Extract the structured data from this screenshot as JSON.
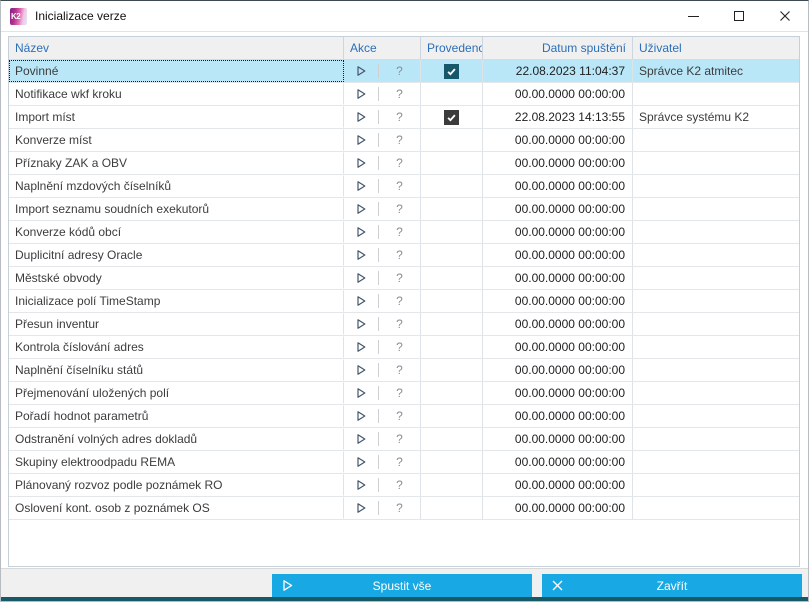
{
  "window": {
    "title": "Inicializace verze",
    "app_badge": "K2"
  },
  "table": {
    "columns": [
      {
        "label": "Název"
      },
      {
        "label": "Akce"
      },
      {
        "label": "Provedeno"
      },
      {
        "label": "Datum spuštění"
      },
      {
        "label": "Uživatel"
      }
    ],
    "action_icons": {
      "run": "play-icon",
      "help_glyph": "?"
    },
    "rows": [
      {
        "name": "Povinné",
        "done": true,
        "date": "22.08.2023 11:04:37",
        "user": "Správce K2 atmitec",
        "selected": true
      },
      {
        "name": "Notifikace wkf kroku",
        "done": false,
        "date": "00.00.0000 00:00:00",
        "user": "",
        "selected": false
      },
      {
        "name": "Import míst",
        "done": true,
        "date": "22.08.2023 14:13:55",
        "user": "Správce systému K2",
        "selected": false
      },
      {
        "name": "Konverze míst",
        "done": false,
        "date": "00.00.0000 00:00:00",
        "user": "",
        "selected": false
      },
      {
        "name": "Příznaky ZAK a OBV",
        "done": false,
        "date": "00.00.0000 00:00:00",
        "user": "",
        "selected": false
      },
      {
        "name": "Naplnění mzdových číselníků",
        "done": false,
        "date": "00.00.0000 00:00:00",
        "user": "",
        "selected": false
      },
      {
        "name": "Import seznamu soudních exekutorů",
        "done": false,
        "date": "00.00.0000 00:00:00",
        "user": "",
        "selected": false
      },
      {
        "name": "Konverze kódů obcí",
        "done": false,
        "date": "00.00.0000 00:00:00",
        "user": "",
        "selected": false
      },
      {
        "name": "Duplicitní adresy Oracle",
        "done": false,
        "date": "00.00.0000 00:00:00",
        "user": "",
        "selected": false
      },
      {
        "name": "Městské obvody",
        "done": false,
        "date": "00.00.0000 00:00:00",
        "user": "",
        "selected": false
      },
      {
        "name": "Inicializace polí TimeStamp",
        "done": false,
        "date": "00.00.0000 00:00:00",
        "user": "",
        "selected": false
      },
      {
        "name": "Přesun inventur",
        "done": false,
        "date": "00.00.0000 00:00:00",
        "user": "",
        "selected": false
      },
      {
        "name": "Kontrola číslování adres",
        "done": false,
        "date": "00.00.0000 00:00:00",
        "user": "",
        "selected": false
      },
      {
        "name": "Naplnění číselníku států",
        "done": false,
        "date": "00.00.0000 00:00:00",
        "user": "",
        "selected": false
      },
      {
        "name": "Přejmenování uložených polí",
        "done": false,
        "date": "00.00.0000 00:00:00",
        "user": "",
        "selected": false
      },
      {
        "name": "Pořadí hodnot parametrů",
        "done": false,
        "date": "00.00.0000 00:00:00",
        "user": "",
        "selected": false
      },
      {
        "name": "Odstranění volných adres dokladů",
        "done": false,
        "date": "00.00.0000 00:00:00",
        "user": "",
        "selected": false
      },
      {
        "name": "Skupiny elektroodpadu REMA",
        "done": false,
        "date": "00.00.0000 00:00:00",
        "user": "",
        "selected": false
      },
      {
        "name": "Plánovaný rozvoz podle poznámek RO",
        "done": false,
        "date": "00.00.0000 00:00:00",
        "user": "",
        "selected": false
      },
      {
        "name": "Oslovení kont. osob z poznámek OS",
        "done": false,
        "date": "00.00.0000 00:00:00",
        "user": "",
        "selected": false
      }
    ]
  },
  "footer": {
    "run_all_label": "Spustit vše",
    "close_label": "Zavřít"
  },
  "colors": {
    "accent": "#18a9e4",
    "selected_row": "#b9e7f8",
    "checkbox": "#3c3c3c",
    "checkbox_selected": "#17576a",
    "header_text": "#2c6fb7",
    "bottom_strip": "#175967"
  }
}
